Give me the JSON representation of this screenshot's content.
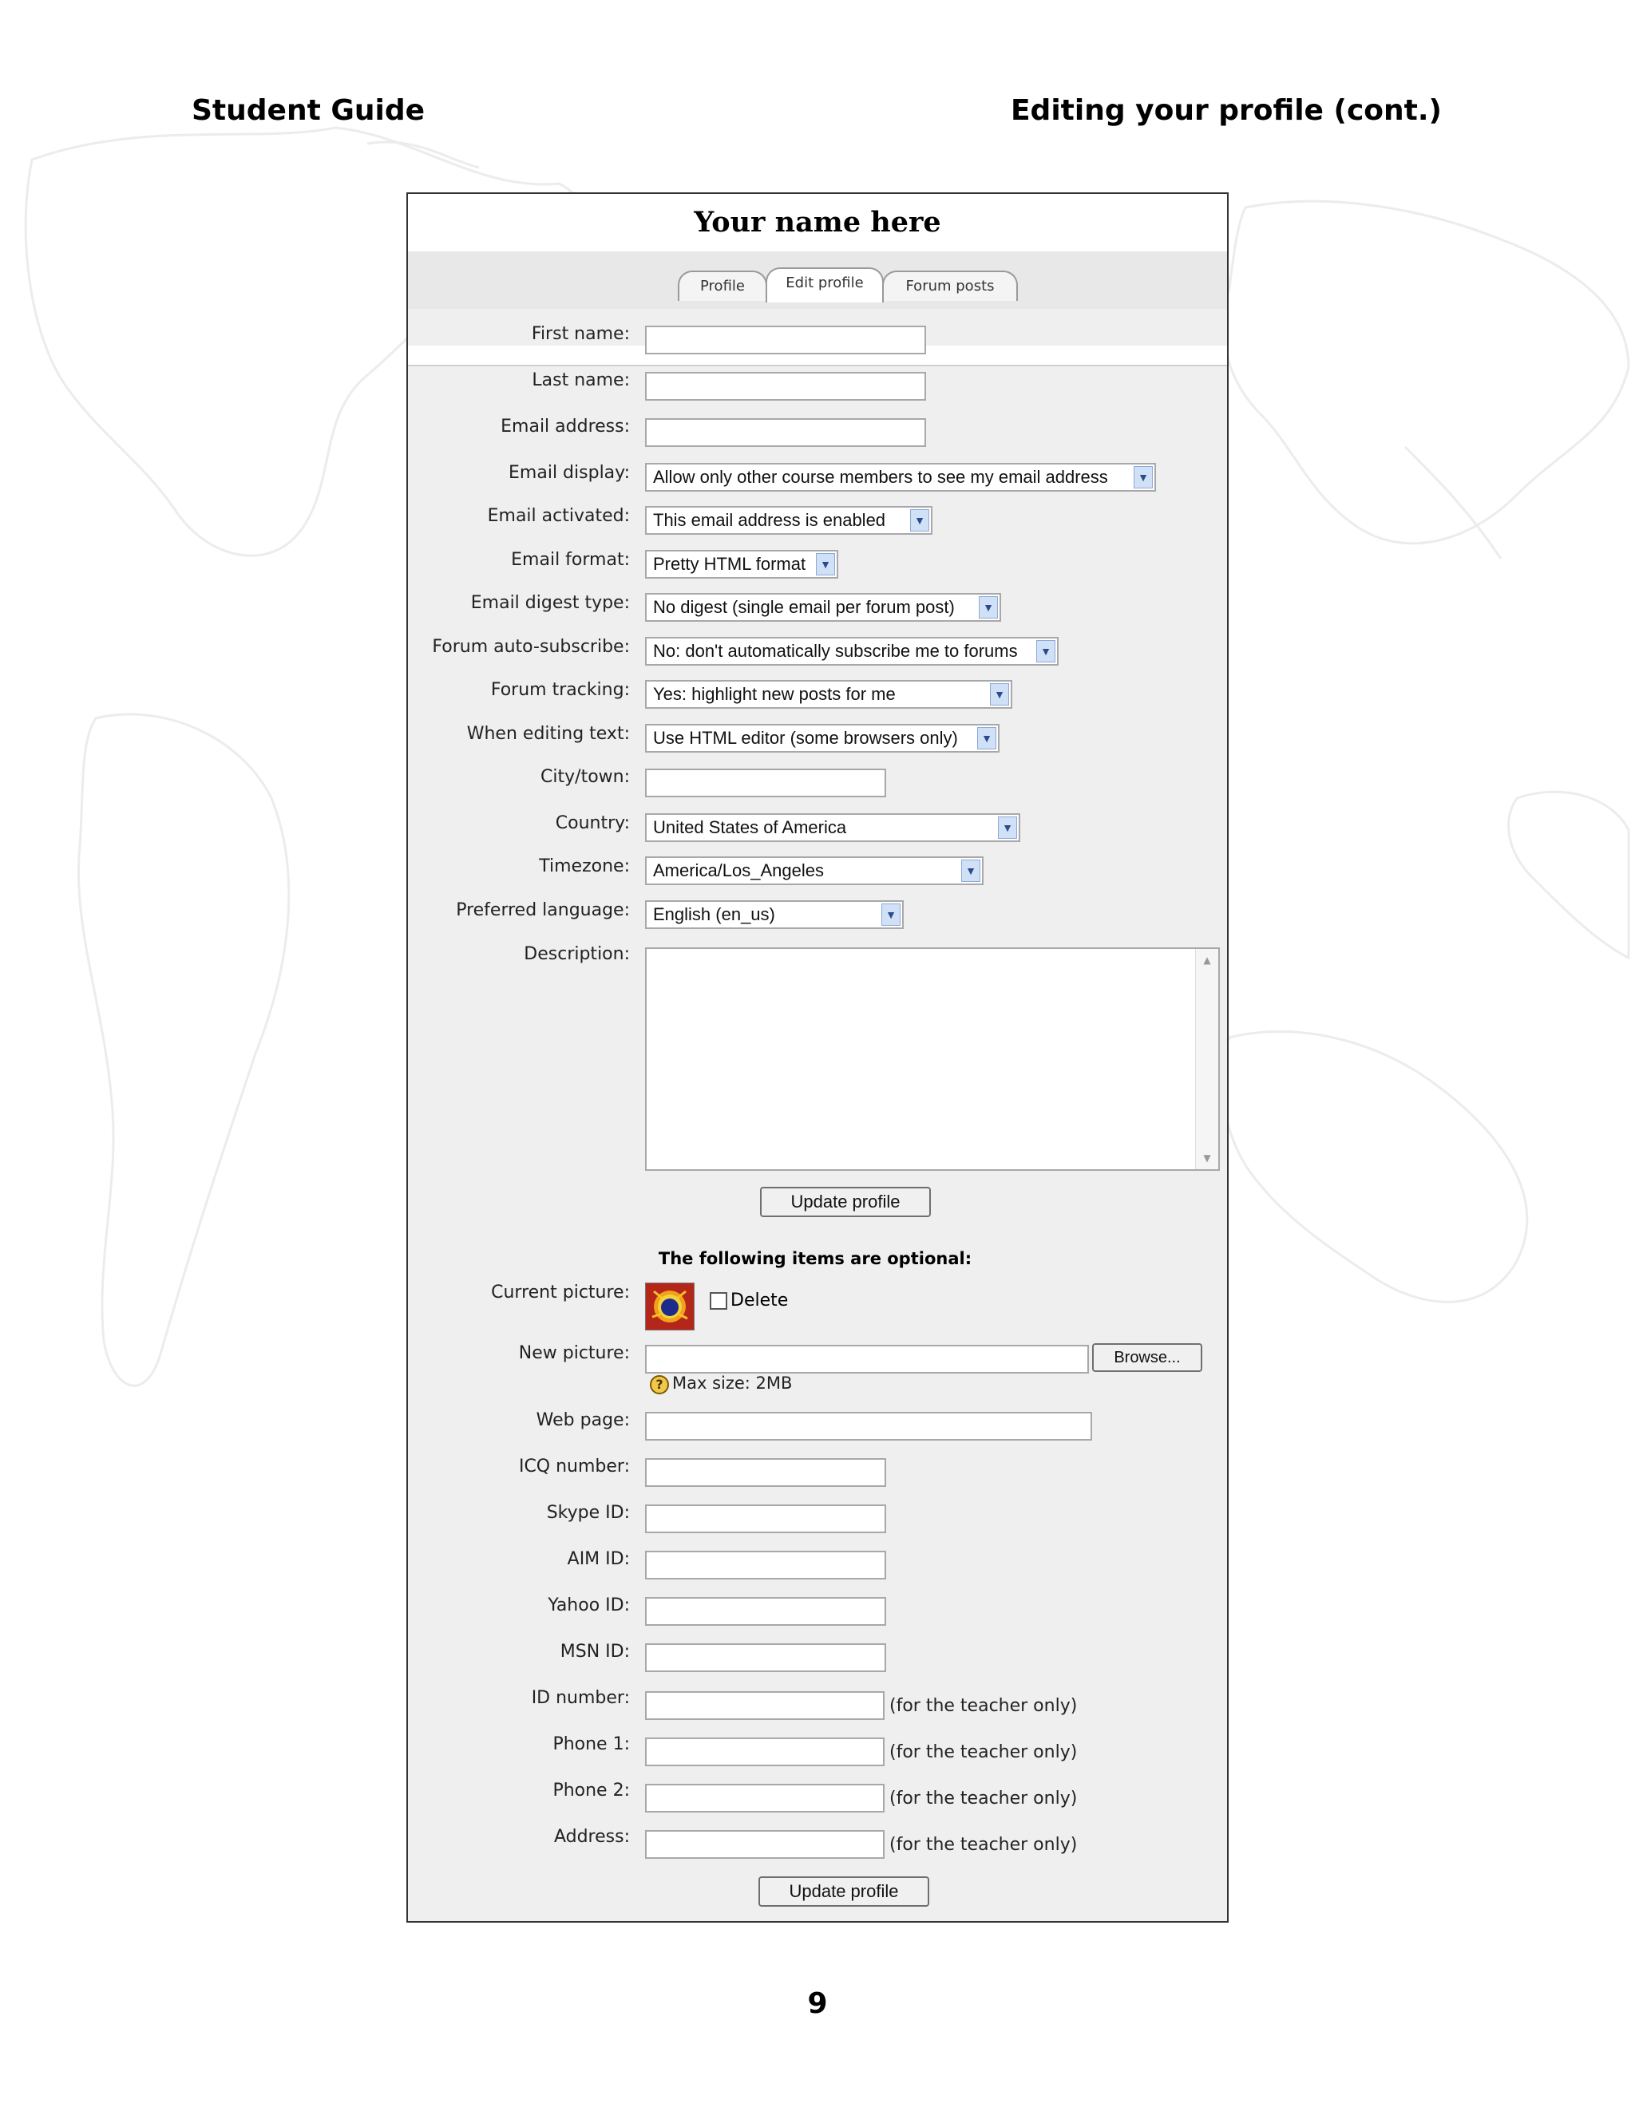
{
  "page": {
    "header_left": "Student Guide",
    "header_right": "Editing your profile (cont.)",
    "page_number": "9"
  },
  "form": {
    "title": "Your name here",
    "tabs": [
      {
        "label": "Profile"
      },
      {
        "label": "Edit profile",
        "active": true
      },
      {
        "label": "Forum posts"
      }
    ],
    "fields": {
      "first_name": {
        "label": "First name:",
        "value": ""
      },
      "last_name": {
        "label": "Last name:",
        "value": ""
      },
      "email_address": {
        "label": "Email address:",
        "value": ""
      },
      "email_display": {
        "label": "Email display:",
        "value": "Allow only other course members to see my email address"
      },
      "email_activated": {
        "label": "Email activated:",
        "value": "This email address is enabled"
      },
      "email_format": {
        "label": "Email format:",
        "value": "Pretty HTML format"
      },
      "email_digest_type": {
        "label": "Email digest type:",
        "value": "No digest (single email per forum post)"
      },
      "forum_auto_subscribe": {
        "label": "Forum auto-subscribe:",
        "value": "No: don't automatically subscribe me to forums"
      },
      "forum_tracking": {
        "label": "Forum tracking:",
        "value": "Yes: highlight new posts for me"
      },
      "when_editing_text": {
        "label": "When editing text:",
        "value": "Use HTML editor (some browsers only)"
      },
      "city_town": {
        "label": "City/town:",
        "value": ""
      },
      "country": {
        "label": "Country:",
        "value": "United States of America"
      },
      "timezone": {
        "label": "Timezone:",
        "value": "America/Los_Angeles"
      },
      "preferred_language": {
        "label": "Preferred language:",
        "value": "English (en_us)"
      },
      "description": {
        "label": "Description:",
        "value": ""
      }
    },
    "update_button": "Update profile",
    "optional_heading": "The following items are optional:",
    "optional": {
      "current_picture": {
        "label": "Current picture:",
        "delete_label": "Delete",
        "delete_checked": false
      },
      "new_picture": {
        "label": "New picture:",
        "browse_label": "Browse...",
        "value": "",
        "help_text": "Max size: 2MB"
      },
      "web_page": {
        "label": "Web page:",
        "value": ""
      },
      "icq_number": {
        "label": "ICQ number:",
        "value": ""
      },
      "skype_id": {
        "label": "Skype ID:",
        "value": ""
      },
      "aim_id": {
        "label": "AIM ID:",
        "value": ""
      },
      "yahoo_id": {
        "label": "Yahoo ID:",
        "value": ""
      },
      "msn_id": {
        "label": "MSN ID:",
        "value": ""
      },
      "id_number": {
        "label": "ID number:",
        "value": "",
        "note": "(for the teacher only)"
      },
      "phone_1": {
        "label": "Phone 1:",
        "value": "",
        "note": "(for the teacher only)"
      },
      "phone_2": {
        "label": "Phone 2:",
        "value": "",
        "note": "(for the teacher only)"
      },
      "address": {
        "label": "Address:",
        "value": "",
        "note": "(for the teacher only)"
      }
    },
    "icons": {
      "select_arrow": "chevron-down-icon",
      "help": "help-icon",
      "picture": "user-picture-icon"
    }
  }
}
